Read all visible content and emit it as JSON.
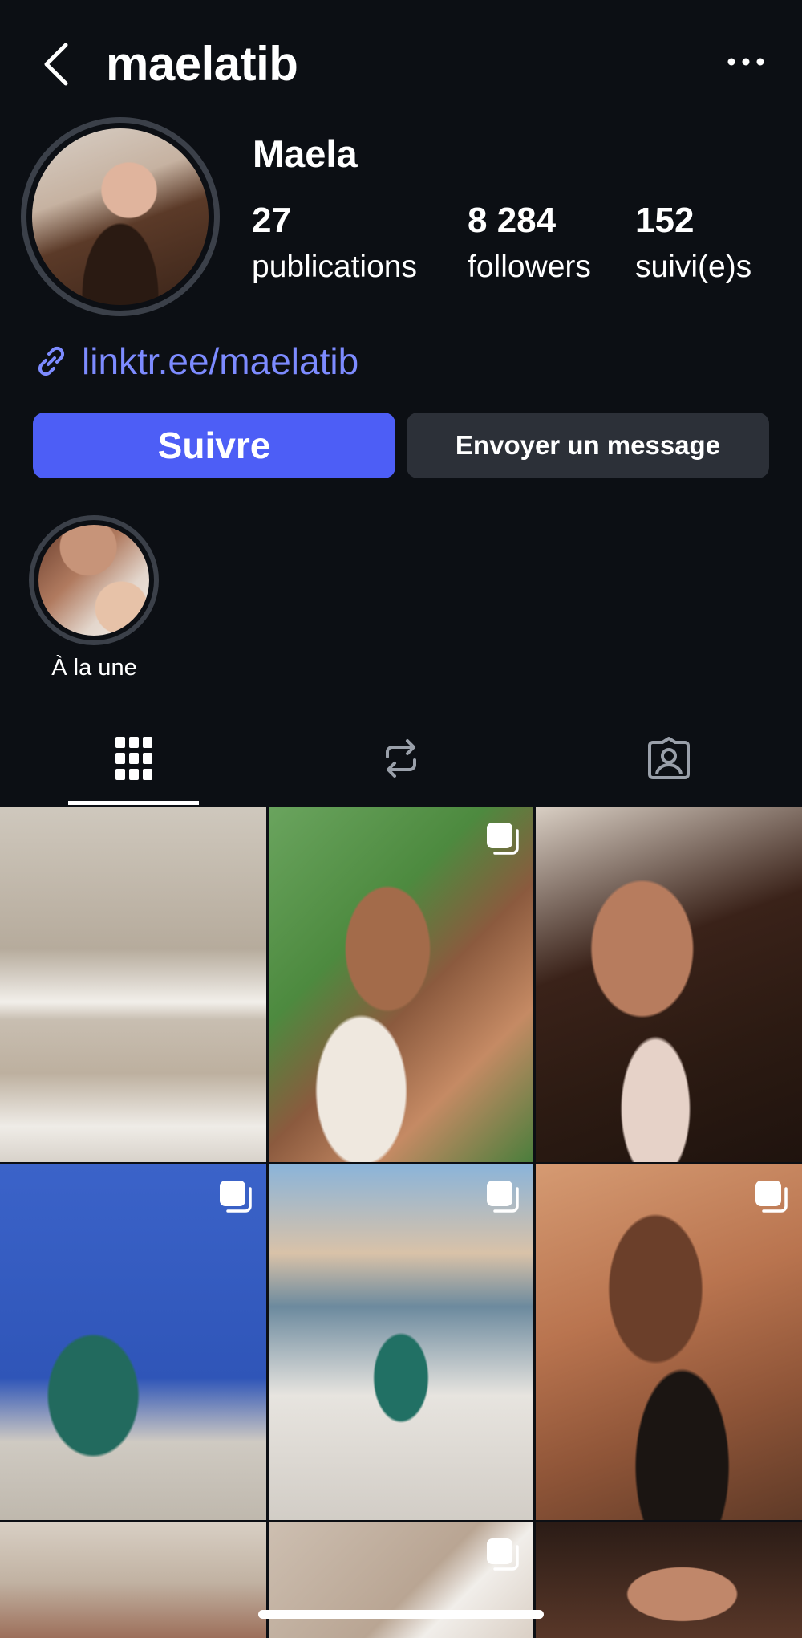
{
  "header": {
    "username": "maelatib",
    "back_icon": "chevron-left-icon",
    "more_icon": "more-horizontal-icon"
  },
  "profile": {
    "display_name": "Maela",
    "stats": {
      "posts": {
        "value": "27",
        "label": "publications"
      },
      "followers": {
        "value": "8 284",
        "label": "followers"
      },
      "following": {
        "value": "152",
        "label": "suivi(e)s"
      }
    },
    "link": "linktr.ee/maelatib",
    "link_icon": "link-icon"
  },
  "actions": {
    "follow_label": "Suivre",
    "message_label": "Envoyer un message"
  },
  "highlights": [
    {
      "label": "À la une"
    }
  ],
  "tabs": [
    {
      "name": "grid",
      "icon": "grid-icon",
      "active": true
    },
    {
      "name": "reels",
      "icon": "repost-icon",
      "active": false
    },
    {
      "name": "tagged",
      "icon": "tagged-user-icon",
      "active": false
    }
  ],
  "colors": {
    "background": "#0c0f14",
    "accent": "#4d5ef6",
    "link": "#7d8bff",
    "secondary_button": "#2c3038"
  }
}
